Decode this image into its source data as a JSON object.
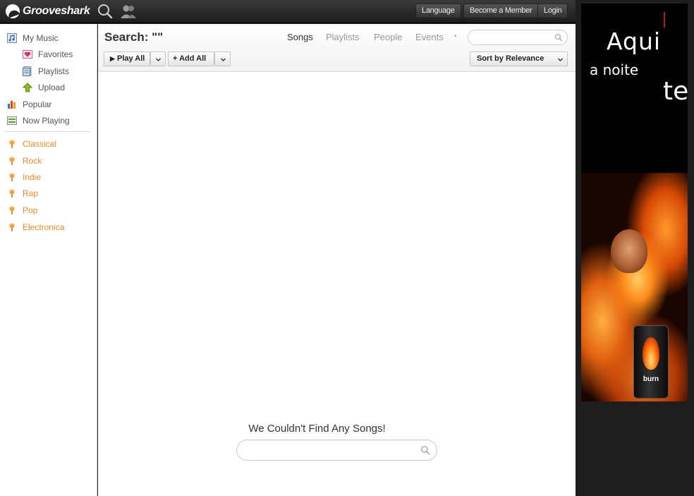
{
  "app": {
    "logo_text": "Grooveshark"
  },
  "topbar": {
    "language_label": "Language",
    "member_label": "Become a Member",
    "login_label": "Login"
  },
  "sidebar": {
    "items": [
      {
        "label": "My Music",
        "icon": "music-note-icon"
      },
      {
        "label": "Favorites",
        "icon": "heart-icon"
      },
      {
        "label": "Playlists",
        "icon": "playlist-icon"
      },
      {
        "label": "Upload",
        "icon": "upload-arrow-icon"
      },
      {
        "label": "Popular",
        "icon": "bar-chart-icon"
      },
      {
        "label": "Now Playing",
        "icon": "now-playing-icon"
      }
    ],
    "genres": [
      "Classical",
      "Rock",
      "Indie",
      "Rap",
      "Pop",
      "Electronica"
    ]
  },
  "main": {
    "search_title": "Search: \"\"",
    "tabs": [
      "Songs",
      "Playlists",
      "People",
      "Events"
    ],
    "tab_dot": "•",
    "play_all_label": "Play All",
    "add_all_label": "Add All",
    "sort_label": "Sort by Relevance",
    "empty_message": "We Couldn't Find Any Songs!"
  },
  "ad": {
    "word1": "Aqui",
    "word2": "a noite",
    "word3": "te",
    "can_brand": "burn"
  },
  "colors": {
    "genre": "#f08a30",
    "topbar": "#2a2a2a"
  }
}
